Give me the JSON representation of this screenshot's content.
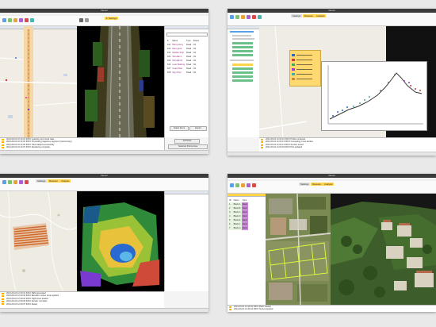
{
  "window_title": "Viewer",
  "panels": [
    {
      "name": "road-survey",
      "menu": [
        "File"
      ],
      "ribbon_tabs": [
        "1: Settings"
      ],
      "log_lines": [
        "2021-09-01 10:14:01  INFO  Loading point cloud data...",
        "2021-09-01 10:14:02  INFO  Processing trajectory segment (road survey)",
        "2021-09-01 10:14:05  INFO  Tiles loaded successfully",
        "2021-09-01 10:14:07  INFO  Rendering complete"
      ],
      "table_header": [
        "#",
        "Name",
        "Type",
        "Status"
      ],
      "table_rows": [
        [
          "101",
          "Ramp Entry",
          "Road",
          "Ok"
        ],
        [
          "102",
          "Ramp Exit",
          "Road",
          "Ok"
        ],
        [
          "103",
          "Median Strip",
          "Road",
          "Ok"
        ],
        [
          "104",
          "Shoulder L",
          "Road",
          "Ok"
        ],
        [
          "105",
          "Shoulder R",
          "Road",
          "Ok"
        ],
        [
          "106",
          "Lane Marking",
          "Road",
          "Ok"
        ],
        [
          "107",
          "Guard Rail",
          "Road",
          "Ok"
        ],
        [
          "108",
          "Sign Post",
          "Road",
          "Ok"
        ]
      ],
      "buttons": [
        "Select Items",
        "Export"
      ],
      "status_buttons": [
        "All Points",
        "Selected Points Area"
      ]
    },
    {
      "name": "profile-plot",
      "ribbon_tabs": [
        "Settings",
        "Measure",
        "Analysis"
      ],
      "log_lines": [
        "2021-09-01 11:02:11  INFO  Profile extracted",
        "2021-09-01 11:02:12  INFO  Computing cross-section",
        "2021-09-01 11:02:14  INFO  Section saved",
        "2021-09-01 11:02:15  INFO  Plot updated"
      ]
    },
    {
      "name": "terrain-dem",
      "ribbon_tabs": [
        "Settings",
        "Measure",
        "Analysis"
      ],
      "log_lines": [
        "2021-09-01 12:20:01  INFO  DEM generated",
        "2021-09-01 12:20:03  INFO  Elevation colour ramp applied",
        "2021-09-01 12:20:04  INFO  Flight lines loaded",
        "2021-09-01 12:20:06  INFO  Render complete",
        "2021-09-01 12:20:07  INFO  Ready"
      ]
    },
    {
      "name": "village-mesh",
      "menu": [
        "File",
        "Processing",
        "Measurements",
        "Tools",
        "Help"
      ],
      "ribbon_tabs": [
        "Settings",
        "Measure",
        "Analysis"
      ],
      "table_header": [
        "ID",
        "Name",
        "Type"
      ],
      "table_rows": [
        [
          "1",
          "Block A",
          "Mesh"
        ],
        [
          "2",
          "Block B",
          "Mesh"
        ],
        [
          "3",
          "Block C",
          "Mesh"
        ],
        [
          "4",
          "Block D",
          "Mesh"
        ],
        [
          "5",
          "Block E",
          "Mesh"
        ],
        [
          "6",
          "Block F",
          "Mesh"
        ],
        [
          "7",
          "Block G",
          "Mesh"
        ]
      ],
      "log_lines": [
        "2021-09-01 13:40:10  INFO  Mesh loaded",
        "2021-09-01 13:40:12  INFO  Texture applied",
        "2021-09-01 13:40:14  INFO  Grid overlay created",
        "2021-09-01 13:40:15  INFO  Ready"
      ]
    }
  ]
}
